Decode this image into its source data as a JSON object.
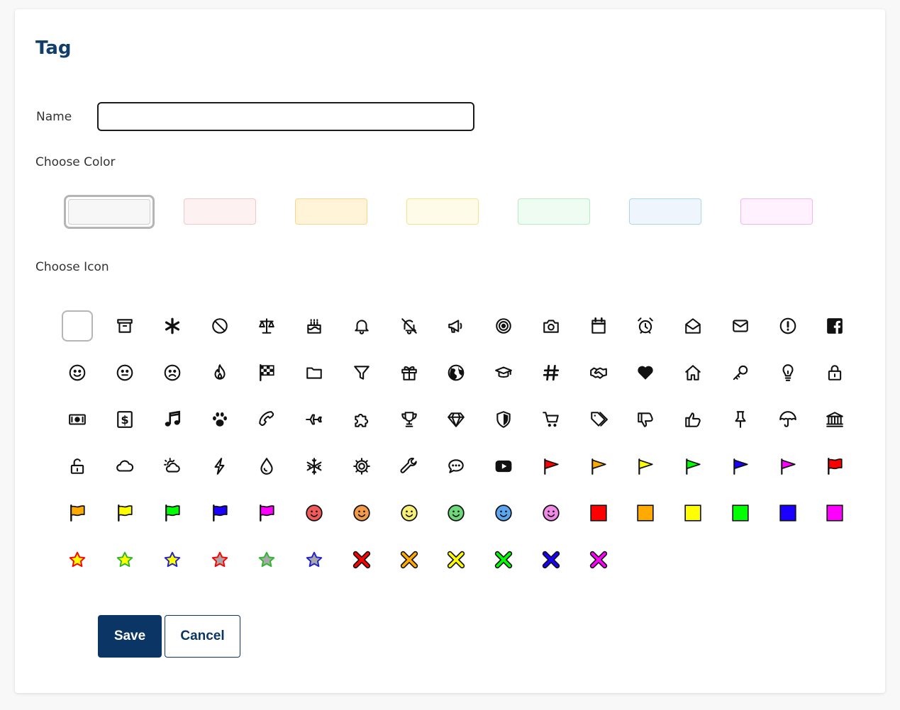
{
  "form": {
    "title": "Tag",
    "name_label": "Name",
    "name_value": "",
    "name_placeholder": "",
    "color_label": "Choose Color",
    "icon_label": "Choose Icon",
    "save_label": "Save",
    "cancel_label": "Cancel"
  },
  "colors": [
    {
      "name": "gray",
      "fill": "#f7f7f7",
      "border": "#cfcfcf",
      "selected": true
    },
    {
      "name": "red",
      "fill": "#fdf1f1",
      "border": "#f6c6c6",
      "selected": false
    },
    {
      "name": "orange",
      "fill": "#fff3d8",
      "border": "#fbd58c",
      "selected": false
    },
    {
      "name": "yellow",
      "fill": "#fffbe9",
      "border": "#f8e28c",
      "selected": false
    },
    {
      "name": "green",
      "fill": "#eefcf1",
      "border": "#b6ecc1",
      "selected": false
    },
    {
      "name": "blue",
      "fill": "#eef5fd",
      "border": "#a9d7ef",
      "selected": false
    },
    {
      "name": "pink",
      "fill": "#fff1fd",
      "border": "#f3b6ee",
      "selected": false
    }
  ],
  "icons": [
    "blank",
    "archive",
    "asterisk",
    "ban",
    "scale",
    "birthday-cake",
    "bell",
    "bell-slash",
    "bullhorn",
    "bullseye",
    "camera",
    "calendar",
    "alarm-clock",
    "envelope-open",
    "envelope",
    "exclamation-circle",
    "facebook",
    "smile",
    "meh",
    "frown",
    "fire",
    "checkered-flag",
    "folder",
    "filter",
    "gift",
    "globe",
    "graduation-cap",
    "hashtag",
    "handshake",
    "heart",
    "home",
    "key",
    "lightbulb",
    "lock",
    "money-bill",
    "dollar-square",
    "music",
    "paw",
    "phone",
    "plane",
    "puzzle-piece",
    "trophy",
    "gem",
    "shield",
    "shopping-cart",
    "tags",
    "thumbs-down",
    "thumbs-up",
    "thumbtack",
    "umbrella",
    "bank",
    "unlock",
    "cloud",
    "cloud-sun",
    "bolt",
    "tint",
    "snowflake",
    "cog",
    "wrench",
    "comment-dots",
    "youtube",
    "flag-red",
    "flag-orange",
    "flag-yellow",
    "flag-green",
    "flag-blue",
    "flag-pink",
    "flag-wave-red",
    "flag-wave-orange",
    "flag-wave-yellow",
    "flag-wave-green",
    "flag-wave-blue",
    "flag-wave-pink",
    "face-red",
    "face-orange",
    "face-yellow",
    "face-green",
    "face-blue",
    "face-pink",
    "square-red",
    "square-orange",
    "square-yellow",
    "square-green",
    "square-blue",
    "square-pink",
    "star-red",
    "star-green",
    "star-blue",
    "star-gray-red",
    "star-gray-green",
    "star-gray-blue",
    "x-red",
    "x-orange",
    "x-yellow",
    "x-green",
    "x-blue",
    "x-pink"
  ],
  "selected_icon": "blank",
  "palette": {
    "red": "#ff0000",
    "orange": "#ffaa00",
    "yellow": "#ffff00",
    "green": "#00ff00",
    "blue": "#1a00ff",
    "pink": "#ff00ff",
    "gray": "#a8a8a8",
    "face-red": "#f05a5a",
    "face-orange": "#f39b4b",
    "face-yellow": "#f6f074",
    "face-green": "#6ed97a",
    "face-blue": "#5aa6f0",
    "face-pink": "#f08ae6"
  }
}
